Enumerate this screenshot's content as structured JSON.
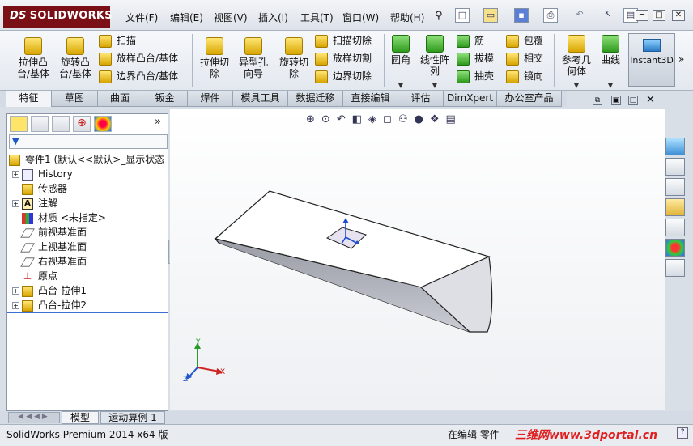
{
  "app": {
    "name": "SOLIDWORKS",
    "logo_prefix": "DS"
  },
  "menu": [
    "文件(F)",
    "编辑(E)",
    "视图(V)",
    "插入(I)",
    "工具(T)",
    "窗口(W)",
    "帮助(H)"
  ],
  "ribbon": {
    "extrude_boss": "拉伸凸\n台/基体",
    "revolve_boss": "旋转凸\n台/基体",
    "sweep": "扫描",
    "loft_boss": "放样凸台/基体",
    "boundary_boss": "边界凸台/基体",
    "extrude_cut": "拉伸切\n除",
    "hole_wizard": "异型孔\n向导",
    "revolve_cut": "旋转切\n除",
    "sweep_cut": "扫描切除",
    "loft_cut": "放样切割",
    "boundary_cut": "边界切除",
    "fillet": "圆角",
    "linear_pattern": "线性阵\n列",
    "rib": "筋",
    "draft": "拔模",
    "shell": "抽壳",
    "wrap": "包覆",
    "intersect": "相交",
    "mirror": "镜向",
    "ref_geometry": "参考几\n何体",
    "curves": "曲线",
    "instant3d": "Instant3D"
  },
  "tabs": [
    "特征",
    "草图",
    "曲面",
    "钣金",
    "焊件",
    "模具工具",
    "数据迁移",
    "直接编辑",
    "评估",
    "DimXpert",
    "办公室产品"
  ],
  "active_tab": "特征",
  "tree": {
    "root": "零件1  (默认<<默认>_显示状态",
    "items": [
      "History",
      "传感器",
      "注解",
      "材质 <未指定>",
      "前视基准面",
      "上视基准面",
      "右视基准面",
      "原点",
      "凸台-拉伸1",
      "凸台-拉伸2"
    ]
  },
  "triad": {
    "x": "X",
    "y": "Y",
    "z": "Z"
  },
  "bottom_tabs": [
    "模型",
    "运动算例 1"
  ],
  "status": {
    "version": "SolidWorks Premium 2014 x64 版",
    "mode": "在编辑 零件",
    "watermark": "三维网www.3dportal.cn"
  },
  "colors": {
    "accent_red": "#7a0f16",
    "selection_blue": "#1f4fd0"
  }
}
